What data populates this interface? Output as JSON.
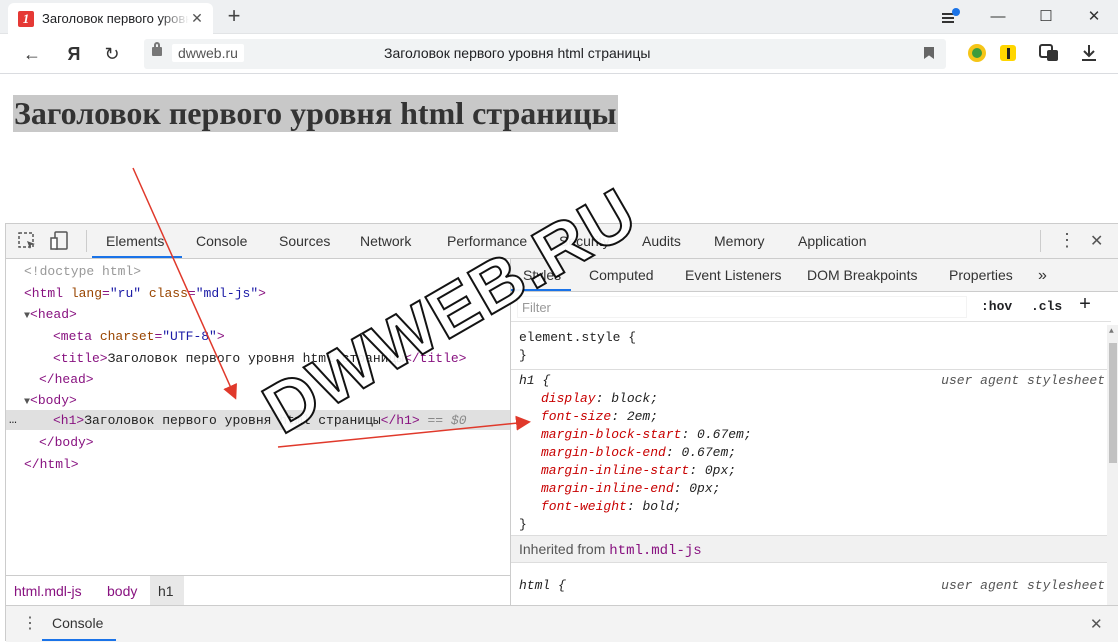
{
  "browser": {
    "tab_title": "Заголовок первого уровня html страницы",
    "favicon_letter": "1",
    "domain": "dwweb.ru",
    "page_title": "Заголовок первого уровня html страницы",
    "yandex_button": "Я"
  },
  "page": {
    "h1_text": "Заголовок первого уровня html страницы"
  },
  "devtools": {
    "tabs": [
      "Elements",
      "Console",
      "Sources",
      "Network",
      "Performance",
      "Security",
      "Audits",
      "Memory",
      "Application"
    ],
    "active_tab": "Elements",
    "elements": {
      "doctype": "<!doctype html>",
      "html_open_tag": "<html",
      "html_lang_attr": "lang",
      "html_lang_val": "\"ru\"",
      "html_class_attr": "class",
      "html_class_val": "\"mdl-js\"",
      "head_open": "<head>",
      "meta_open": "<meta",
      "meta_attr": "charset",
      "meta_val": "\"UTF-8\"",
      "title_open": "<title>",
      "title_text": "Заголовок первого уровня html страницы",
      "title_close": "</title>",
      "head_close": "</head>",
      "body_open": "<body>",
      "h1_open": "<h1>",
      "h1_text": "Заголовок первого уровня html страницы",
      "h1_close": "</h1>",
      "selected_marker": "== $0",
      "body_close": "</body>",
      "html_close": "</html>",
      "row_dots": "…"
    },
    "breadcrumbs": [
      "html.mdl-js",
      "body",
      "h1"
    ],
    "styles_tabs": [
      "Styles",
      "Computed",
      "Event Listeners",
      "DOM Breakpoints",
      "Properties"
    ],
    "more_tabs": "»",
    "filter_placeholder": "Filter",
    "hov": ":hov",
    "cls": ".cls",
    "add_rule": "+",
    "element_style": "element.style {",
    "close_brace": "}",
    "h1_selector": "h1 {",
    "ua_label": "user agent stylesheet",
    "rules": [
      {
        "prop": "display",
        "val": "block;"
      },
      {
        "prop": "font-size",
        "val": "2em;"
      },
      {
        "prop": "margin-block-start",
        "val": "0.67em;"
      },
      {
        "prop": "margin-block-end",
        "val": "0.67em;"
      },
      {
        "prop": "margin-inline-start",
        "val": "0px;"
      },
      {
        "prop": "margin-inline-end",
        "val": "0px;"
      },
      {
        "prop": "font-weight",
        "val": "bold;"
      }
    ],
    "inherited_label": "Inherited from",
    "inherited_selector": "html.mdl-js",
    "html_selector": "html {",
    "console_drawer_label": "Console"
  },
  "watermark": "DWWEB.RU",
  "colors": {
    "accent": "#1a73e8",
    "arrow": "#e0392b",
    "tag": "#881280",
    "attr": "#994500",
    "prop": "#c80000"
  }
}
